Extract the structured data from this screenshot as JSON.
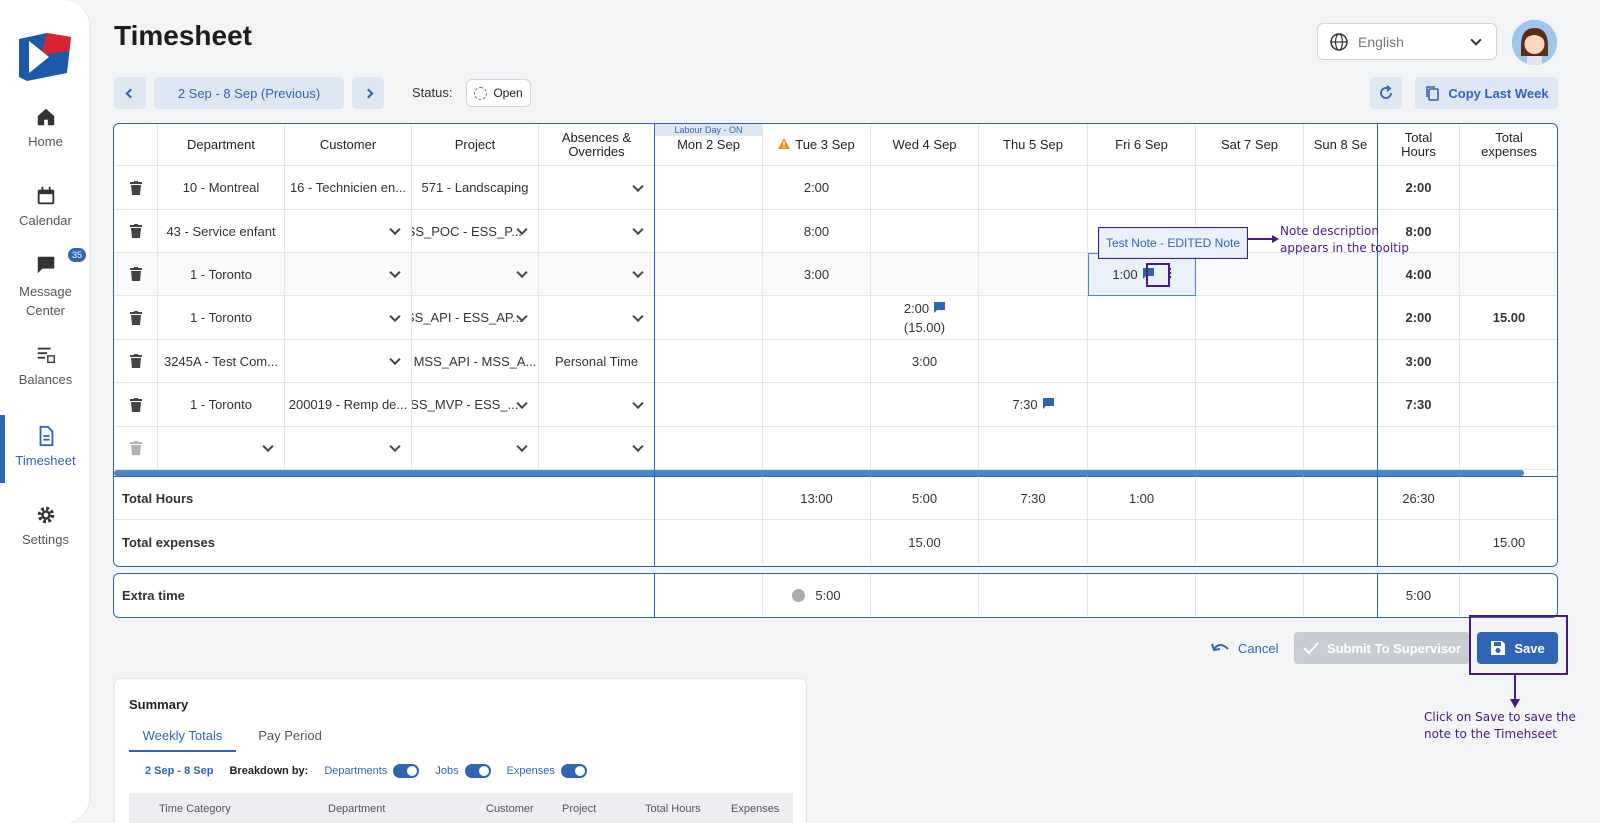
{
  "nav": {
    "items": [
      {
        "label": "Home",
        "icon": "home-icon"
      },
      {
        "label": "Calendar",
        "icon": "calendar-icon"
      },
      {
        "label": "Message Center",
        "icon": "message-icon",
        "badge": "35"
      },
      {
        "label": "Balances",
        "icon": "balances-icon"
      },
      {
        "label": "Timesheet",
        "icon": "timesheet-icon",
        "active": true
      },
      {
        "label": "Settings",
        "icon": "gear-icon"
      }
    ]
  },
  "header": {
    "title": "Timesheet",
    "language": "English"
  },
  "toolbar": {
    "period": "2 Sep - 8 Sep (Previous)",
    "status_label": "Status:",
    "status_value": "Open",
    "copy_last_week": "Copy Last Week"
  },
  "grid": {
    "columns": [
      "Department",
      "Customer",
      "Project",
      "Absences & Overrides",
      "Mon 2 Sep",
      "Tue 3 Sep",
      "Wed 4 Sep",
      "Thu 5 Sep",
      "Fri 6 Sep",
      "Sat 7 Sep",
      "Sun 8 Se",
      "Total Hours",
      "Total expenses"
    ],
    "holiday_label": "Labour Day - ON",
    "rows": [
      {
        "dept": "10 - Montreal",
        "cust": "16 - Technicien en...",
        "proj": "571 - Landscaping",
        "abs": "",
        "tue": "2:00",
        "wed": "",
        "thu": "",
        "fri": "",
        "total": "2:00",
        "exp": ""
      },
      {
        "dept": "43 - Service enfant",
        "cust": "",
        "proj": "ESS_POC - ESS_P...",
        "abs": "",
        "tue": "8:00",
        "wed": "",
        "thu": "",
        "fri": "",
        "total": "8:00",
        "exp": ""
      },
      {
        "dept": "1 - Toronto",
        "cust": "",
        "proj": "",
        "abs": "",
        "tue": "3:00",
        "wed": "",
        "thu": "",
        "fri": "1:00",
        "total": "4:00",
        "exp": ""
      },
      {
        "dept": "1 - Toronto",
        "cust": "",
        "proj": "ESS_API - ESS_AP...",
        "abs": "",
        "tue": "",
        "wed": "2:00",
        "wed2": "(15.00)",
        "thu": "",
        "fri": "",
        "total": "2:00",
        "exp": "15.00"
      },
      {
        "dept": "3245A - Test Com...",
        "cust": "",
        "proj": "MSS_API - MSS_A...",
        "abs": "Personal Time",
        "tue": "",
        "wed": "3:00",
        "thu": "",
        "fri": "",
        "total": "3:00",
        "exp": ""
      },
      {
        "dept": "1 - Toronto",
        "cust": "200019 - Remp de...",
        "proj": "ESS_MVP - ESS_...",
        "abs": "",
        "tue": "",
        "wed": "",
        "thu": "7:30",
        "fri": "",
        "total": "7:30",
        "exp": ""
      }
    ],
    "totals": {
      "hours_label": "Total Hours",
      "hours": [
        "",
        "13:00",
        "5:00",
        "7:30",
        "1:00",
        "",
        "",
        "26:30",
        ""
      ],
      "exp_label": "Total expenses",
      "exp": [
        "",
        "",
        "15.00",
        "",
        "",
        "",
        "",
        "",
        "15.00"
      ]
    },
    "tooltip": "Test Note - EDITED Note"
  },
  "extra": {
    "label": "Extra time",
    "tue": "5:00",
    "total": "5:00"
  },
  "actions": {
    "cancel": "Cancel",
    "submit": "Submit To Supervisor",
    "save": "Save"
  },
  "annotations": {
    "note": [
      "Note description",
      "appears in the tooltip"
    ],
    "save": [
      "Click on Save to save the",
      "note to the Timehseet"
    ]
  },
  "summary": {
    "title": "Summary",
    "tabs": [
      "Weekly Totals",
      "Pay Period"
    ],
    "range": "2 Sep - 8 Sep",
    "breakdown_label": "Breakdown by:",
    "toggles": [
      "Departments",
      "Jobs",
      "Expenses"
    ],
    "table_headers": [
      "Time Category",
      "Department",
      "Customer",
      "Project",
      "Total Hours",
      "Expenses"
    ]
  },
  "colors": {
    "accent": "#2f65b4",
    "annotation": "#4b1a86",
    "warning": "#f08a1c"
  }
}
